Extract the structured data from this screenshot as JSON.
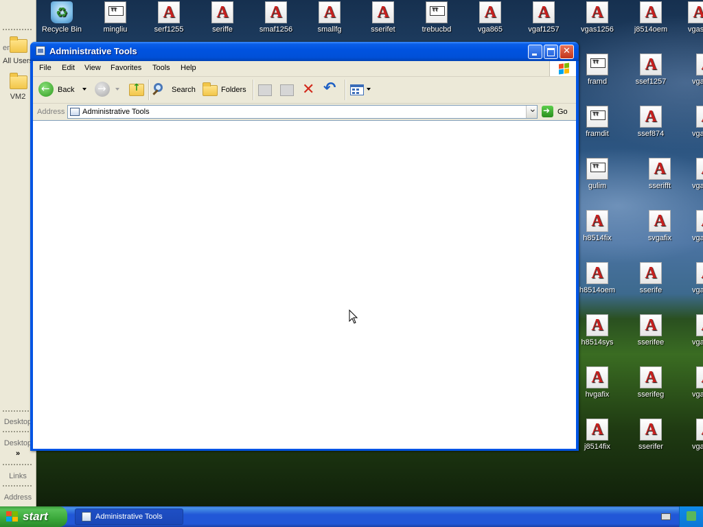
{
  "desktop": {
    "top_icons": [
      {
        "label": "Recycle Bin",
        "icon": "recycle-bin-icon"
      },
      {
        "label": "mingliu",
        "icon": "truetype-font-icon"
      },
      {
        "label": "serf1255",
        "icon": "font-file-icon"
      },
      {
        "label": "seriffe",
        "icon": "font-file-icon"
      },
      {
        "label": "smaf1256",
        "icon": "font-file-icon"
      },
      {
        "label": "smallfg",
        "icon": "font-file-icon"
      },
      {
        "label": "sserifet",
        "icon": "font-file-icon"
      },
      {
        "label": "trebucbd",
        "icon": "truetype-font-icon"
      },
      {
        "label": "vga865",
        "icon": "font-file-icon"
      },
      {
        "label": "vgaf1257",
        "icon": "font-file-icon"
      },
      {
        "label": "vgas1256",
        "icon": "font-file-icon"
      },
      {
        "label": "j8514oem",
        "icon": "font-file-icon"
      },
      {
        "label": "vgas",
        "icon": "font-file-icon"
      }
    ],
    "col1_icons": [
      {
        "label": "framd",
        "icon": "truetype-font-icon"
      },
      {
        "label": "framdit",
        "icon": "truetype-font-icon"
      },
      {
        "label": "gulim",
        "icon": "truetype-font-icon"
      },
      {
        "label": "h8514fix",
        "icon": "font-file-icon"
      },
      {
        "label": "h8514oem",
        "icon": "font-file-icon"
      },
      {
        "label": "h8514sys",
        "icon": "font-file-icon"
      },
      {
        "label": "hvgafix",
        "icon": "font-file-icon"
      },
      {
        "label": "j8514fix",
        "icon": "font-file-icon"
      }
    ],
    "col2_icons": [
      {
        "label": "ssef1257",
        "icon": "font-file-icon"
      },
      {
        "label": "ssef874",
        "icon": "font-file-icon"
      },
      {
        "label": "sserifft",
        "icon": "font-file-icon"
      },
      {
        "label": "svgafix",
        "icon": "font-file-icon"
      },
      {
        "label": "sserife",
        "icon": "font-file-icon"
      },
      {
        "label": "sserifee",
        "icon": "font-file-icon"
      },
      {
        "label": "sserifeg",
        "icon": "font-file-icon"
      },
      {
        "label": "sserifer",
        "icon": "font-file-icon"
      }
    ],
    "col3_icons": [
      {
        "label": "vga",
        "icon": "font-file-icon"
      },
      {
        "label": "vga",
        "icon": "font-file-icon"
      },
      {
        "label": "vga",
        "icon": "font-file-icon"
      },
      {
        "label": "vga",
        "icon": "font-file-icon"
      },
      {
        "label": "vga",
        "icon": "font-file-icon"
      },
      {
        "label": "vga",
        "icon": "font-file-icon"
      },
      {
        "label": "vga",
        "icon": "font-file-icon"
      },
      {
        "label": "vga",
        "icon": "font-file-icon"
      }
    ]
  },
  "leftbar": {
    "partial_label": "ent",
    "all_users": "All Users",
    "vm2": "VM2",
    "desktop1": "Desktop",
    "desktop2": "Desktop",
    "chevron": "»",
    "links": "Links",
    "address": "Address"
  },
  "window": {
    "title": "Administrative Tools",
    "menu": [
      "File",
      "Edit",
      "View",
      "Favorites",
      "Tools",
      "Help"
    ],
    "toolbar": {
      "back": "Back",
      "search": "Search",
      "folders": "Folders"
    },
    "address": {
      "label": "Address",
      "value": "Administrative Tools",
      "go": "Go"
    }
  },
  "taskbar": {
    "start": "start",
    "task": "Administrative Tools"
  },
  "colors": {
    "titlebar": "#0054e3",
    "start_green": "#3aa83a",
    "taskbar_blue": "#2157d7",
    "font_icon_red": "#c8201e"
  }
}
